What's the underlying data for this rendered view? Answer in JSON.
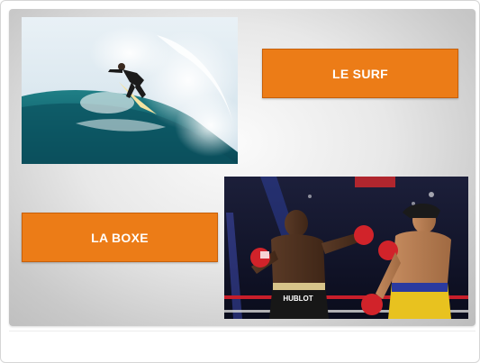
{
  "slide": {
    "labels": {
      "surf": "LE SURF",
      "boxing": "LA BOXE"
    },
    "images": {
      "surf": "surfer-riding-wave-photo",
      "boxing": "boxing-match-photo",
      "boxing_trunks_text": "HUBLOT"
    },
    "colors": {
      "label_fill": "#ec7c17",
      "label_text": "#ffffff",
      "slide_background": "#e6e6e6"
    }
  }
}
